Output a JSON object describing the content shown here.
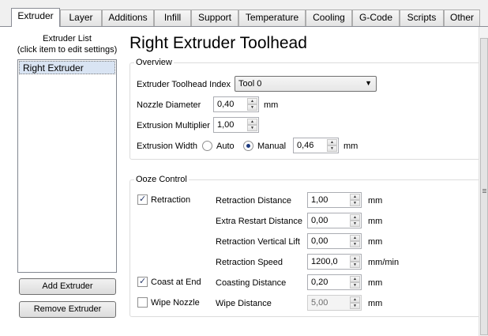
{
  "tabs": [
    {
      "label": "Extruder",
      "active": true
    },
    {
      "label": "Layer"
    },
    {
      "label": "Additions"
    },
    {
      "label": "Infill"
    },
    {
      "label": "Support"
    },
    {
      "label": "Temperature"
    },
    {
      "label": "Cooling"
    },
    {
      "label": "G-Code"
    },
    {
      "label": "Scripts"
    },
    {
      "label": "Other"
    }
  ],
  "sidebar": {
    "title_line1": "Extruder List",
    "title_line2": "(click item to edit settings)",
    "items": [
      {
        "label": "Right Extruder",
        "selected": true
      }
    ],
    "add_button": "Add Extruder",
    "remove_button": "Remove Extruder"
  },
  "main": {
    "title": "Right Extruder Toolhead"
  },
  "overview": {
    "group_label": "Overview",
    "toolhead_index_label": "Extruder Toolhead Index",
    "toolhead_index_value": "Tool 0",
    "nozzle_label": "Nozzle Diameter",
    "nozzle_value": "0,40",
    "nozzle_unit": "mm",
    "multiplier_label": "Extrusion Multiplier",
    "multiplier_value": "1,00",
    "width_label": "Extrusion Width",
    "width_auto": "Auto",
    "width_manual": "Manual",
    "width_mode": "Manual",
    "width_value": "0,46",
    "width_unit": "mm"
  },
  "ooze": {
    "group_label": "Ooze Control",
    "retraction_label": "Retraction",
    "retraction_checked": true,
    "coast_label": "Coast at End",
    "coast_checked": true,
    "wipe_label": "Wipe Nozzle",
    "wipe_checked": false,
    "fields": [
      {
        "label": "Retraction Distance",
        "value": "1,00",
        "unit": "mm",
        "enabled": true
      },
      {
        "label": "Extra Restart Distance",
        "value": "0,00",
        "unit": "mm",
        "enabled": true
      },
      {
        "label": "Retraction Vertical Lift",
        "value": "0,00",
        "unit": "mm",
        "enabled": true
      },
      {
        "label": "Retraction Speed",
        "value": "1200,0",
        "unit": "mm/min",
        "enabled": true
      },
      {
        "label": "Coasting Distance",
        "value": "0,20",
        "unit": "mm",
        "enabled": true
      },
      {
        "label": "Wipe Distance",
        "value": "5,00",
        "unit": "mm",
        "enabled": false
      }
    ]
  },
  "icons": {
    "spin_up": "triangle-up-icon",
    "spin_down": "triangle-down-icon",
    "dropdown": "triangle-down-icon",
    "checkmark": "checkmark-icon"
  },
  "colors": {
    "selected_row": "#d9e4f3",
    "radio_dot": "#1d3a80",
    "check_mark": "#2a3b6b"
  }
}
